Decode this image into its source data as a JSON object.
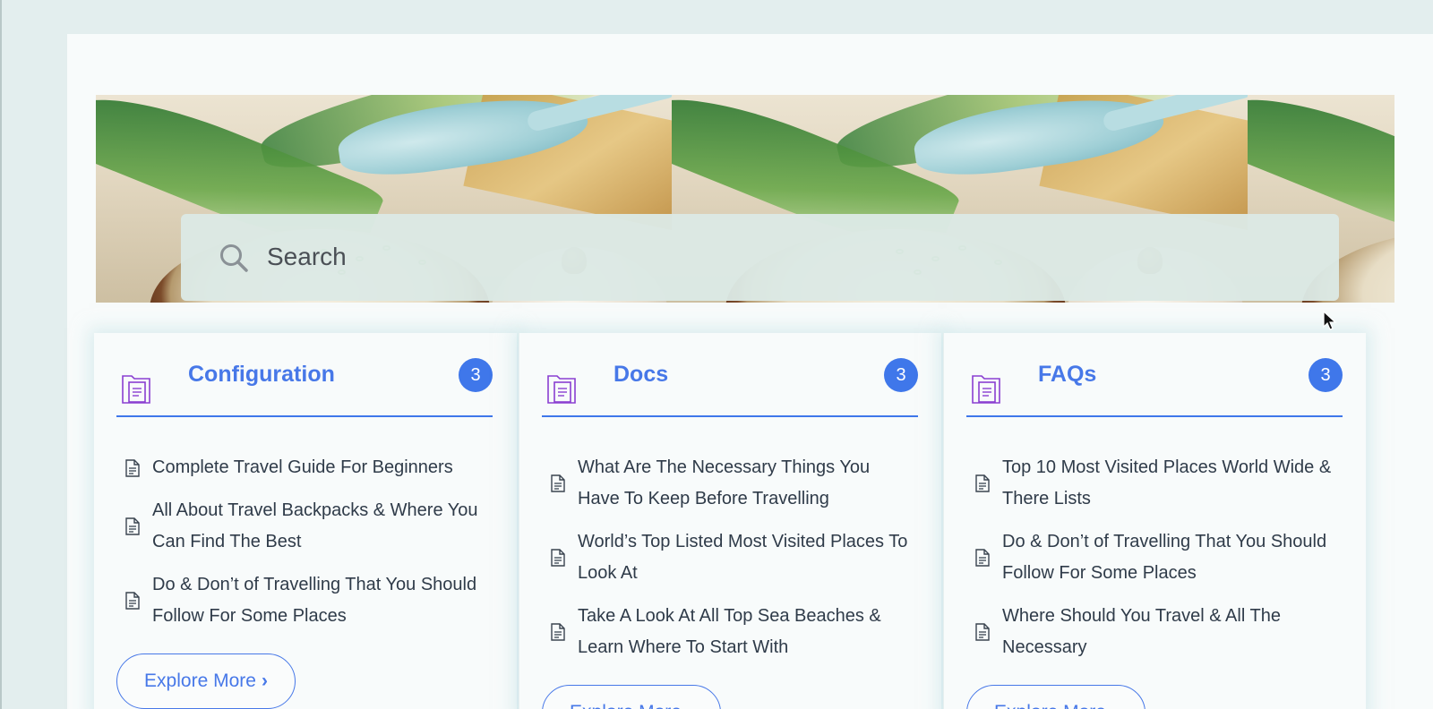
{
  "search": {
    "placeholder": "Search"
  },
  "cards": [
    {
      "title": "Configuration",
      "count": "3",
      "items": [
        "Complete Travel Guide For Beginners",
        "All About Travel Backpacks & Where You Can Find The Best",
        "Do & Don’t of Travelling That You Should Follow For Some Places"
      ],
      "button": "Explore More"
    },
    {
      "title": "Docs",
      "count": "3",
      "items": [
        "What Are The Necessary Things You Have To Keep Before Travelling",
        "World’s Top Listed Most Visited Places To Look At",
        "Take A Look At All Top Sea Beaches & Learn Where To Start With"
      ],
      "button": "Explore More"
    },
    {
      "title": "FAQs",
      "count": "3",
      "items": [
        "Top 10 Most Visited Places World Wide & There Lists",
        "Do & Don’t of Travelling That You Should Follow For Some Places",
        "Where Should You Travel & All The Necessary"
      ],
      "button": "Explore More"
    }
  ],
  "icons": {
    "search": "search-icon",
    "category": "folder-document-icon",
    "doc": "document-icon",
    "explore": "chevron-right-icon"
  },
  "colors": {
    "accent": "#3f77ea",
    "title": "#4778e8",
    "text": "#2f3b49",
    "folder_icon": "#8a3fd1"
  }
}
